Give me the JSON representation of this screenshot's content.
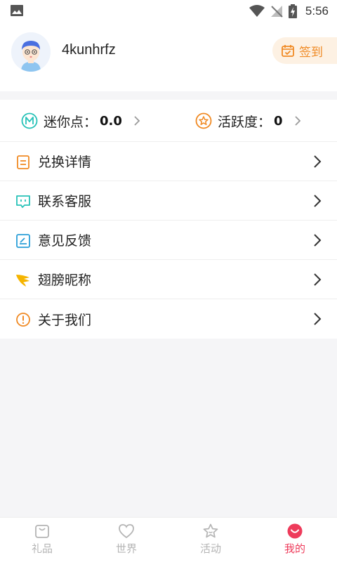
{
  "status_bar": {
    "time": "5:56"
  },
  "profile": {
    "username": "4kunhrfz",
    "signin_label": "签到"
  },
  "stats": [
    {
      "label": "迷你点：",
      "value": "0.0"
    },
    {
      "label": "活跃度：",
      "value": "0"
    }
  ],
  "menu": [
    {
      "label": "兑换详情",
      "icon": "list-doc-icon"
    },
    {
      "label": "联系客服",
      "icon": "chat-bubble-icon"
    },
    {
      "label": "意见反馈",
      "icon": "feedback-edit-icon"
    },
    {
      "label": "翅膀昵称",
      "icon": "wing-icon"
    },
    {
      "label": "关于我们",
      "icon": "info-icon"
    }
  ],
  "tabs": [
    {
      "label": "礼品",
      "icon": "gift-bag-icon",
      "active": false
    },
    {
      "label": "世界",
      "icon": "heart-icon",
      "active": false
    },
    {
      "label": "活动",
      "icon": "star-face-icon",
      "active": false
    },
    {
      "label": "我的",
      "icon": "smile-face-icon",
      "active": true
    }
  ],
  "colors": {
    "accent_orange": "#f08a24",
    "active_red": "#ee3b5b",
    "inactive_gray": "#b4b4b4",
    "teal": "#27c2b8"
  }
}
